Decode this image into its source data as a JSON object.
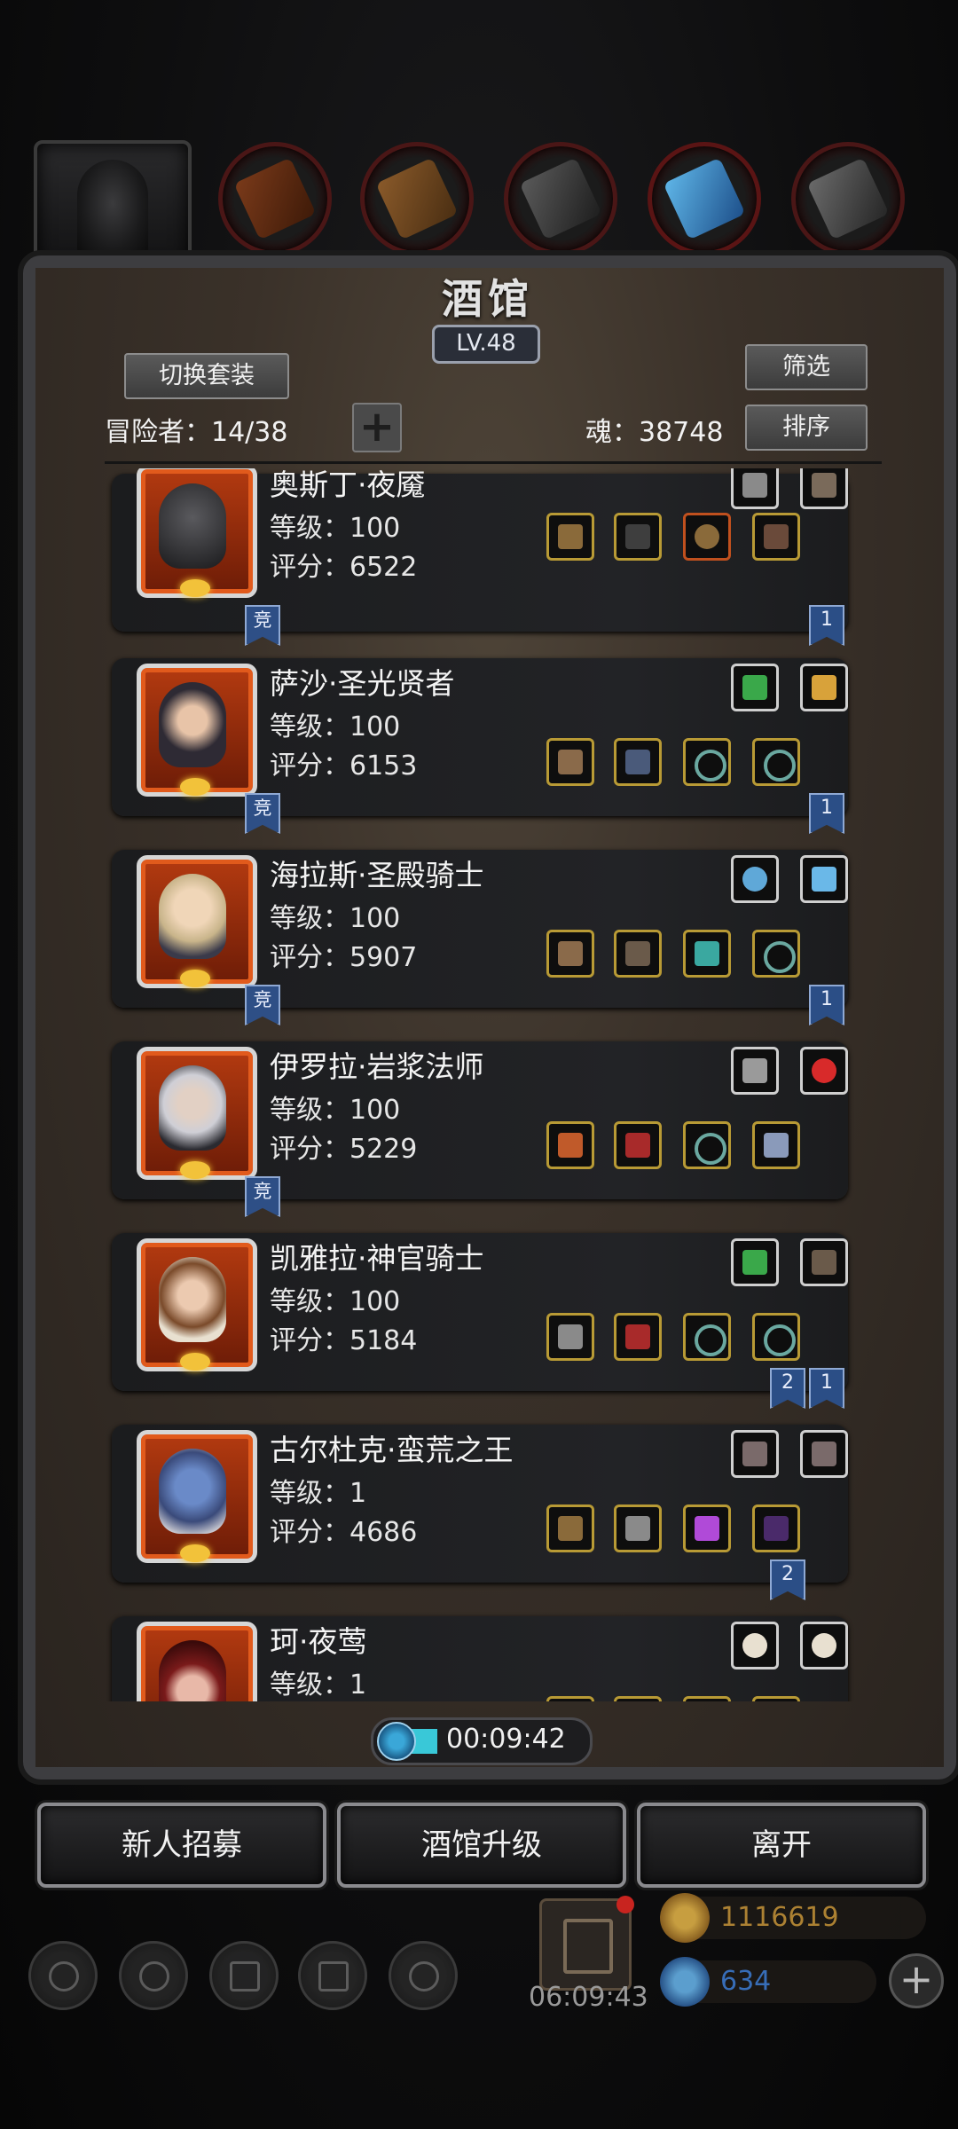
{
  "screen": {
    "title": "酒馆",
    "level": "LV.48"
  },
  "controls": {
    "switch_outfit": "切换套装",
    "filter": "筛选",
    "sort": "排序",
    "adventurers_label": "冒险者：14/38",
    "plus": "+",
    "soul_label": "魂：38748"
  },
  "heroes": [
    {
      "name": "奥斯丁·夜魇",
      "level": "等级：100",
      "score": "评分：6522",
      "badges_left": [
        "竞"
      ],
      "badges_right": [
        "1"
      ],
      "portrait": "dark-knight-helmet"
    },
    {
      "name": "萨沙·圣光贤者",
      "level": "等级：100",
      "score": "评分：6153",
      "badges_left": [
        "竞"
      ],
      "badges_right": [
        "1"
      ],
      "portrait": "hooded-priestess"
    },
    {
      "name": "海拉斯·圣殿骑士",
      "level": "等级：100",
      "score": "评分：5907",
      "badges_left": [
        "竞"
      ],
      "badges_right": [
        "1"
      ],
      "portrait": "blond-knight"
    },
    {
      "name": "伊罗拉·岩浆法师",
      "level": "等级：100",
      "score": "评分：5229",
      "badges_left": [
        "竞"
      ],
      "badges_right": [],
      "portrait": "white-haired-mage"
    },
    {
      "name": "凯雅拉·神官骑士",
      "level": "等级：100",
      "score": "评分：5184",
      "badges_left": [],
      "badges_right": [
        "2",
        "1"
      ],
      "portrait": "cleric-knight"
    },
    {
      "name": "古尔杜克·蛮荒之王",
      "level": "等级：1",
      "score": "评分：4686",
      "badges_left": [],
      "badges_right": [
        "2"
      ],
      "portrait": "blue-beast-king"
    },
    {
      "name": "珂·夜莺",
      "level": "等级：1",
      "score": "",
      "badges_left": [],
      "badges_right": [],
      "portrait": "red-hat-rogue"
    }
  ],
  "timer": {
    "label": "00:09:42"
  },
  "actions": {
    "recruit": "新人招募",
    "upgrade": "酒馆升级",
    "leave": "离开"
  },
  "hud": {
    "gift_timer": "06:09:43",
    "gold": "1116619",
    "gems": "634"
  },
  "colors": {
    "gold_text": "#c9963a",
    "gem_text": "#3f7fd6",
    "ribbon_blue": "#2b4e86",
    "slot_gold": "#b89a35",
    "avatar_orange": "#d5501a"
  },
  "icons": [
    "dark-hooded-figure-icon",
    "leather-armor-icon",
    "wooden-shield-icon",
    "iron-plate-icon",
    "blue-crystal-icon",
    "gauntlet-icon"
  ]
}
